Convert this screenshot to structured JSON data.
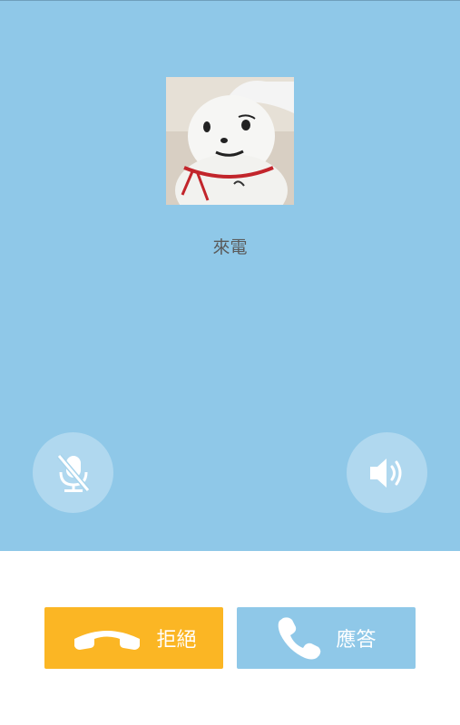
{
  "call": {
    "status_text": "來電"
  },
  "controls": {
    "mute_icon": "microphone-muted-icon",
    "speaker_icon": "speaker-icon"
  },
  "actions": {
    "decline_label": "拒絕",
    "answer_label": "應答",
    "decline_icon": "phone-hangup-icon",
    "answer_icon": "phone-icon"
  },
  "colors": {
    "background": "#8fc8e8",
    "decline": "#fbb624",
    "answer": "#8fc8e8"
  }
}
